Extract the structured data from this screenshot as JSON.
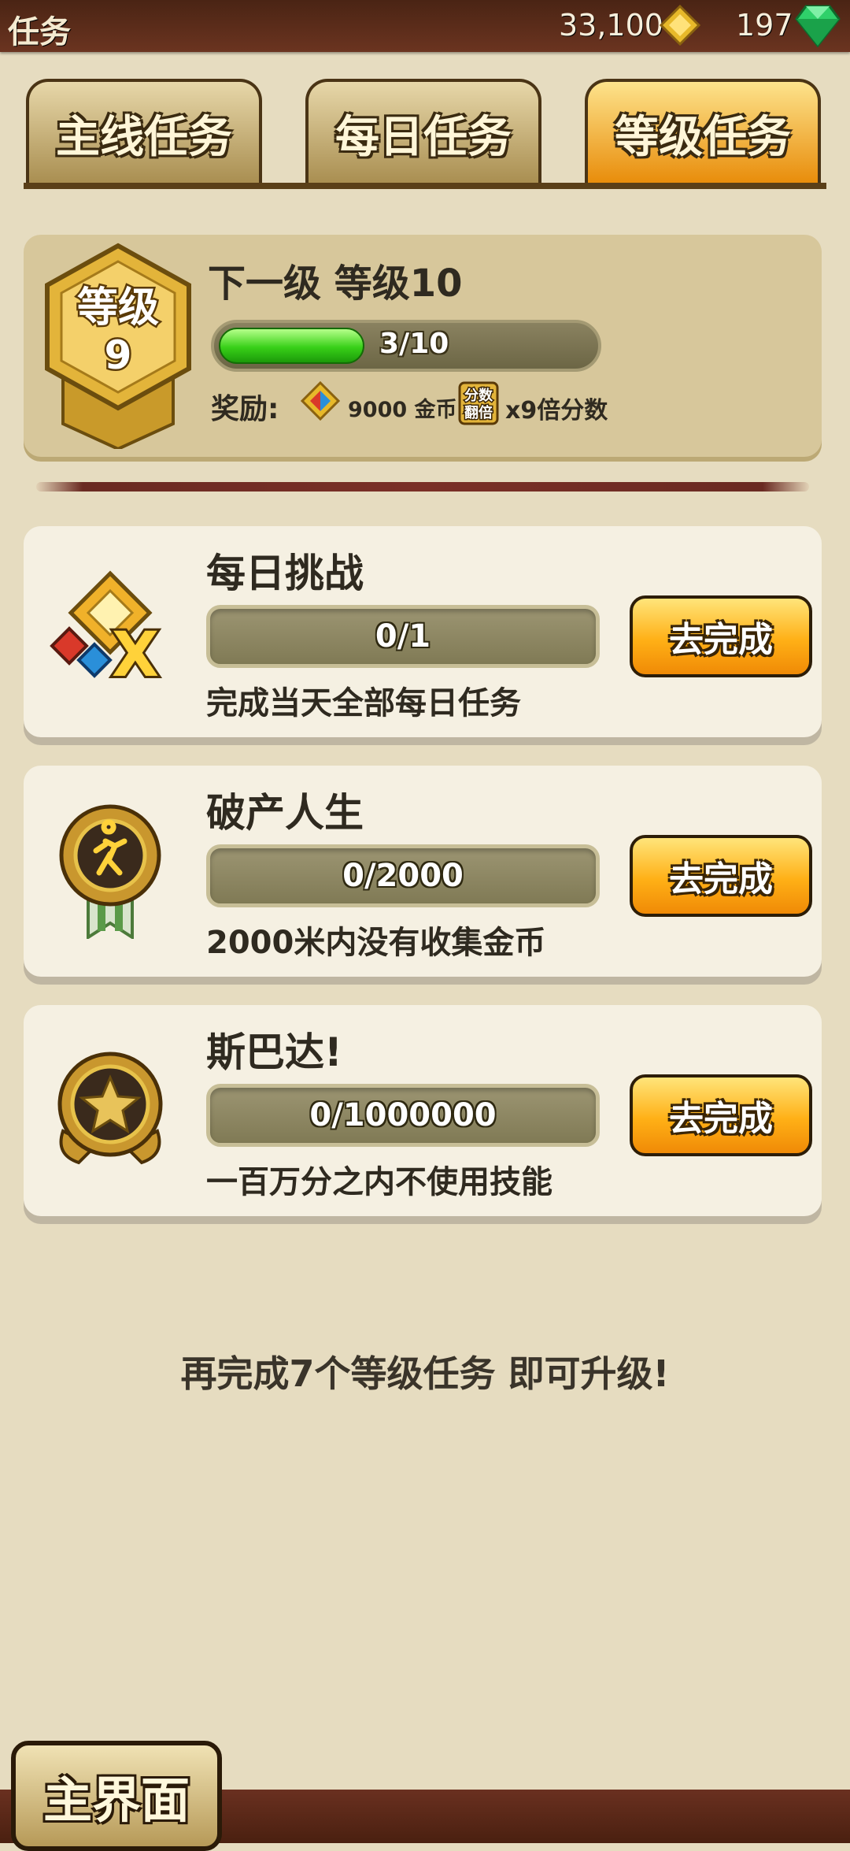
{
  "header": {
    "title": "任务",
    "coins": "33,100",
    "gems": "197"
  },
  "tabs": [
    {
      "label": "主线任务",
      "active": false
    },
    {
      "label": "每日任务",
      "active": false
    },
    {
      "label": "等级任务",
      "active": true
    }
  ],
  "level": {
    "badge_label": "等级",
    "current_level": "9",
    "next_title": "下一级 等级10",
    "progress_text": "3/10",
    "progress_fraction": 0.3,
    "reward_label": "奖励:",
    "reward_coins": "9000 金币",
    "reward_mult_icon_text": [
      "分数",
      "翻倍"
    ],
    "reward_mult": "x9倍分数"
  },
  "tasks": [
    {
      "name": "每日挑战",
      "progress": "0/1",
      "desc": "完成当天全部每日任务",
      "button": "去完成",
      "icon": "daily-challenge-icon"
    },
    {
      "name": "破产人生",
      "progress": "0/2000",
      "desc": "2000米内没有收集金币",
      "button": "去完成",
      "icon": "runner-medal-icon"
    },
    {
      "name": "斯巴达!",
      "progress": "0/1000000",
      "desc": "一百万分之内不使用技能",
      "button": "去完成",
      "icon": "star-medal-icon"
    }
  ],
  "footer": {
    "message": "再完成7个等级任务 即可升级!"
  },
  "home_button": {
    "label": "主界面"
  },
  "colors": {
    "accent_orange": "#f7a21a",
    "progress_green": "#38d018",
    "background": "#e6dcc0"
  }
}
